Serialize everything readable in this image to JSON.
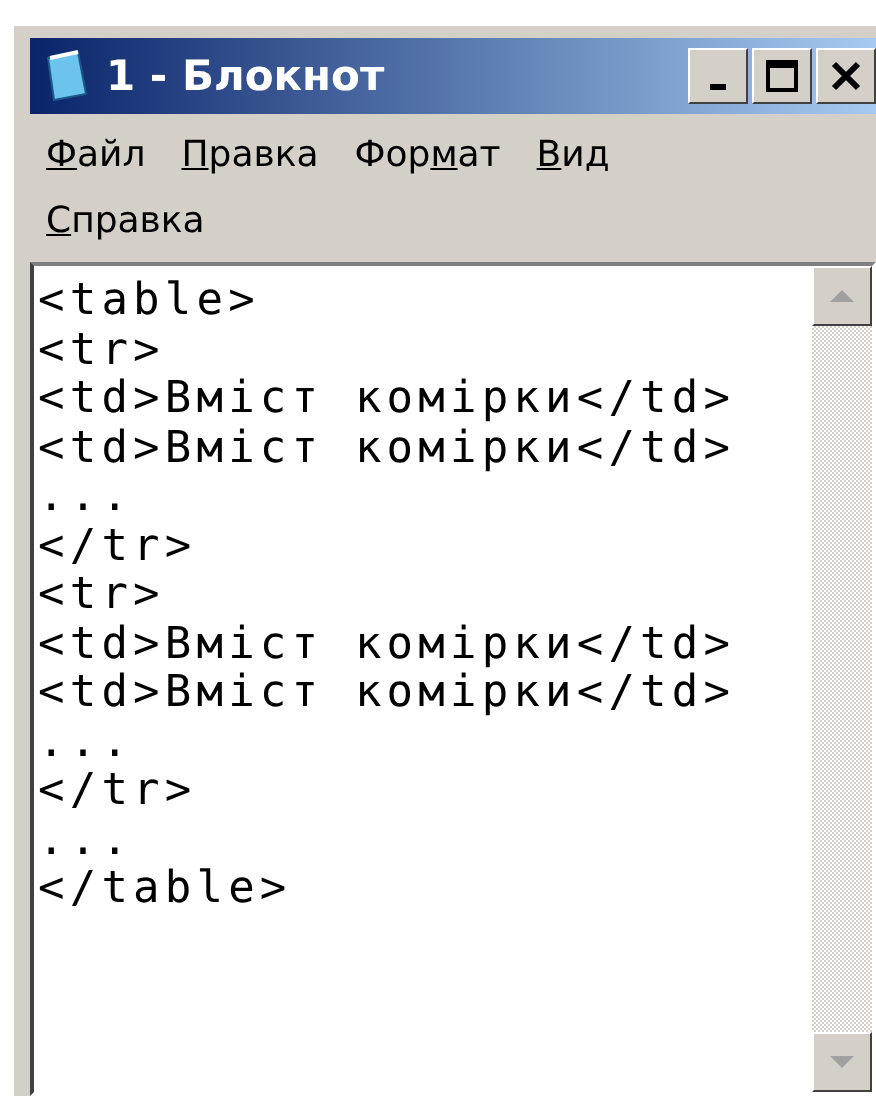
{
  "window": {
    "title": "1 - Блокнот"
  },
  "menu": [
    {
      "accelerator": "Ф",
      "after": "айл"
    },
    {
      "accelerator": "П",
      "after": "равка"
    },
    {
      "before": "Фор",
      "accelerator": "м",
      "after": "ат"
    },
    {
      "accelerator": "В",
      "after": "ид"
    },
    {
      "accelerator": "С",
      "after": "правка"
    }
  ],
  "editor": {
    "lines": [
      "<table>",
      "<tr>",
      "<td>Вміст комірки</td>",
      "<td>Вміст комірки</td>",
      "...",
      "</tr>",
      "<tr>",
      "<td>Вміст комірки</td>",
      "<td>Вміст комірки</td>",
      "...",
      "</tr>",
      "...",
      "</table>"
    ]
  }
}
